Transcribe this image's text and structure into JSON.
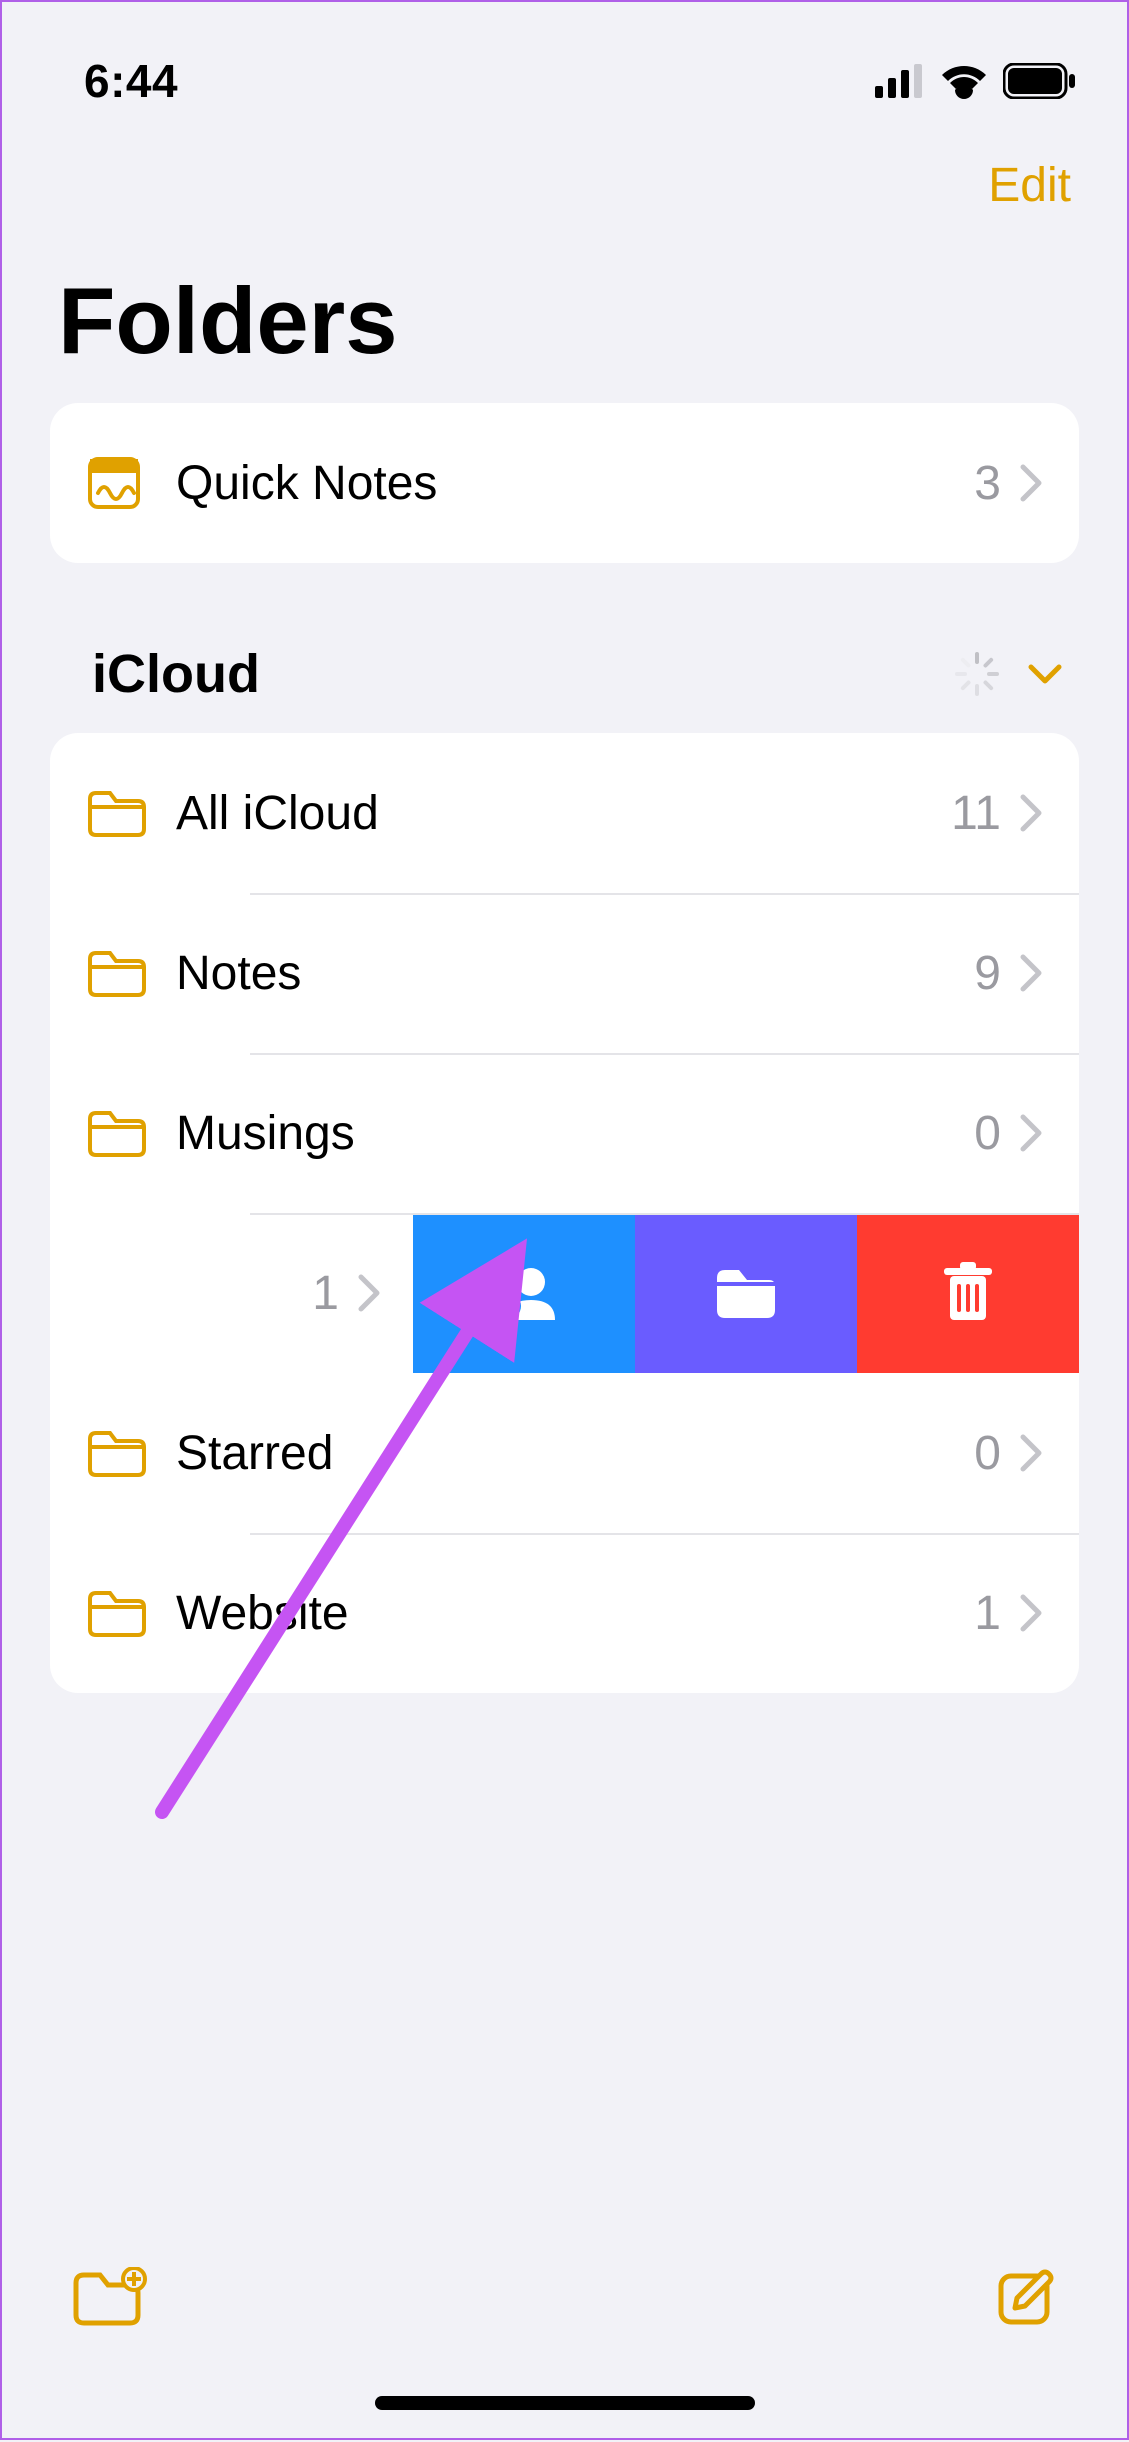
{
  "status": {
    "time": "6:44"
  },
  "nav": {
    "edit_label": "Edit"
  },
  "page": {
    "title": "Folders"
  },
  "quick_notes": {
    "label": "Quick Notes",
    "count": "3"
  },
  "section": {
    "title": "iCloud"
  },
  "folders": [
    {
      "label": "All iCloud",
      "count": "11"
    },
    {
      "label": "Notes",
      "count": "9"
    },
    {
      "label": "Musings",
      "count": "0"
    },
    {
      "label": "Starred",
      "count": "0"
    },
    {
      "label": "Website",
      "count": "1"
    }
  ],
  "swiped_row": {
    "count": "1"
  },
  "colors": {
    "accent": "#e0a100",
    "share": "#1e90ff",
    "move": "#6a5cff",
    "delete": "#ff3b30",
    "annotation": "#c554f3"
  }
}
